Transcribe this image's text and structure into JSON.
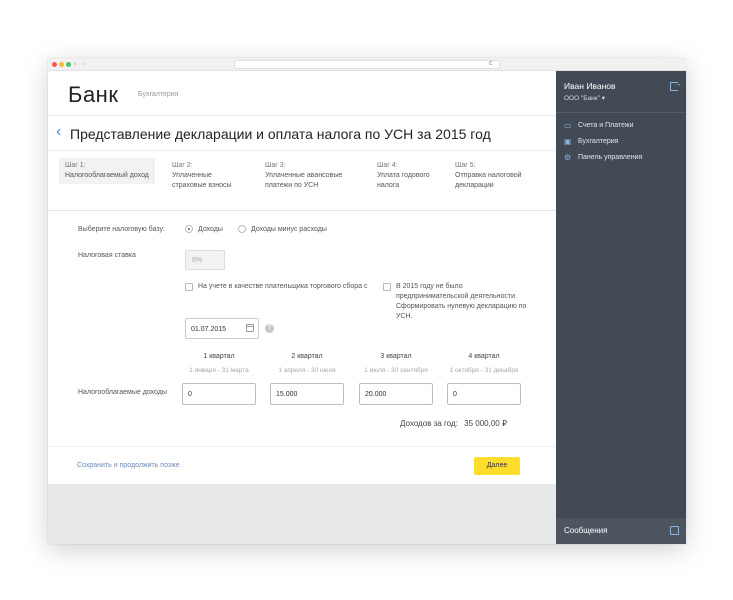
{
  "browser": {
    "back": "‹",
    "forward": "›",
    "reload": "c"
  },
  "header": {
    "logo": "Банк",
    "subtitle": "Бухгалтерия"
  },
  "page": {
    "back_icon": "‹",
    "title": "Представление декларации и оплата налога по УСН за 2015 год"
  },
  "steps": [
    {
      "num": "Шаг 1:",
      "label": "Налогооблагаемый доход",
      "active": true
    },
    {
      "num": "Шаг 2:",
      "label": "Уплаченные страховые взносы"
    },
    {
      "num": "Шаг 3:",
      "label": "Уплаченные авансовые платежи по УСН"
    },
    {
      "num": "Шаг 4:",
      "label": "Уплата годового налога"
    },
    {
      "num": "Шаг 5:",
      "label": "Отправка налоговой декларации"
    }
  ],
  "form": {
    "tax_base_label": "Выберите налоговую базу:",
    "tax_base_options": [
      "Доходы",
      "Доходы минус расходы"
    ],
    "tax_base_selected": "Доходы",
    "rate_label": "Налоговая ставка",
    "rate_value": "6%",
    "trade_fee_checkbox": "На учете в качестве плательщика торгового сбора с",
    "no_activity_checkbox": "В 2015 году не было предпринимательской деятельности. Сформировать нулевую декларацию по УСН.",
    "date_value": "01.07.2015",
    "help": "?",
    "income_label": "Налогооблагаемые доходы",
    "quarters": [
      {
        "title": "1 квартал",
        "range": "1 января - 31 марта",
        "value": "0"
      },
      {
        "title": "2 квартал",
        "range": "1 апреля - 30 июня",
        "value": "15.000"
      },
      {
        "title": "3 квартал",
        "range": "1 июля - 30 сентября",
        "value": "20.000"
      },
      {
        "title": "4 квартал",
        "range": "1 октября - 31 декабря",
        "value": "0"
      }
    ],
    "total_label": "Доходов за год:",
    "total_value": "35 000,00 ₽"
  },
  "footer": {
    "save_later": "Сохранить и продолжить позже",
    "next": "Далее"
  },
  "sidebar": {
    "user_name": "Иван Иванов",
    "org": "ООО \"Банк\" ▾",
    "items": [
      {
        "label": "Счета и Платежи",
        "icon": "wallet-icon"
      },
      {
        "label": "Бухгалтерия",
        "icon": "calendar-icon"
      },
      {
        "label": "Панель управления",
        "icon": "gear-icon"
      }
    ],
    "messages": "Сообщения"
  },
  "colors": {
    "sidebar_bg": "#424a55",
    "accent_yellow": "#ffdd2d",
    "link_blue": "#6b8cb5"
  }
}
